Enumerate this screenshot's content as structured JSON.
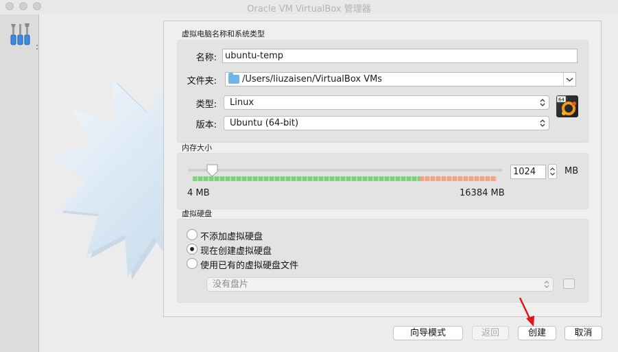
{
  "window": {
    "title": "Oracle VM VirtualBox 管理器"
  },
  "toolbar": {
    "partial_text": ":"
  },
  "name_os": {
    "section_title": "虚拟电脑名称和系统类型",
    "name_label": "名称:",
    "name_value": "ubuntu-temp",
    "folder_label": "文件夹:",
    "folder_value": "/Users/liuzaisen/VirtualBox VMs",
    "type_label": "类型:",
    "type_value": "Linux",
    "version_label": "版本:",
    "version_value": "Ubuntu (64-bit)",
    "os_badge": "64"
  },
  "memory": {
    "section_title": "内存大小",
    "value": "1024",
    "unit": "MB",
    "min_label": "4 MB",
    "max_label": "16384 MB",
    "slider_level": 1024
  },
  "disk": {
    "section_title": "虚拟硬盘",
    "options": [
      "不添加虚拟硬盘",
      "现在创建虚拟硬盘",
      "使用已有的虚拟硬盘文件"
    ],
    "selected_index": 1,
    "existing_disk_placeholder": "没有盘片"
  },
  "buttons": {
    "guided": "向导模式",
    "back": "返回",
    "create": "创建",
    "cancel": "取消"
  },
  "colors": {
    "annotation_arrow": "#e0141a",
    "folder_blue": "#6cb6ef"
  }
}
